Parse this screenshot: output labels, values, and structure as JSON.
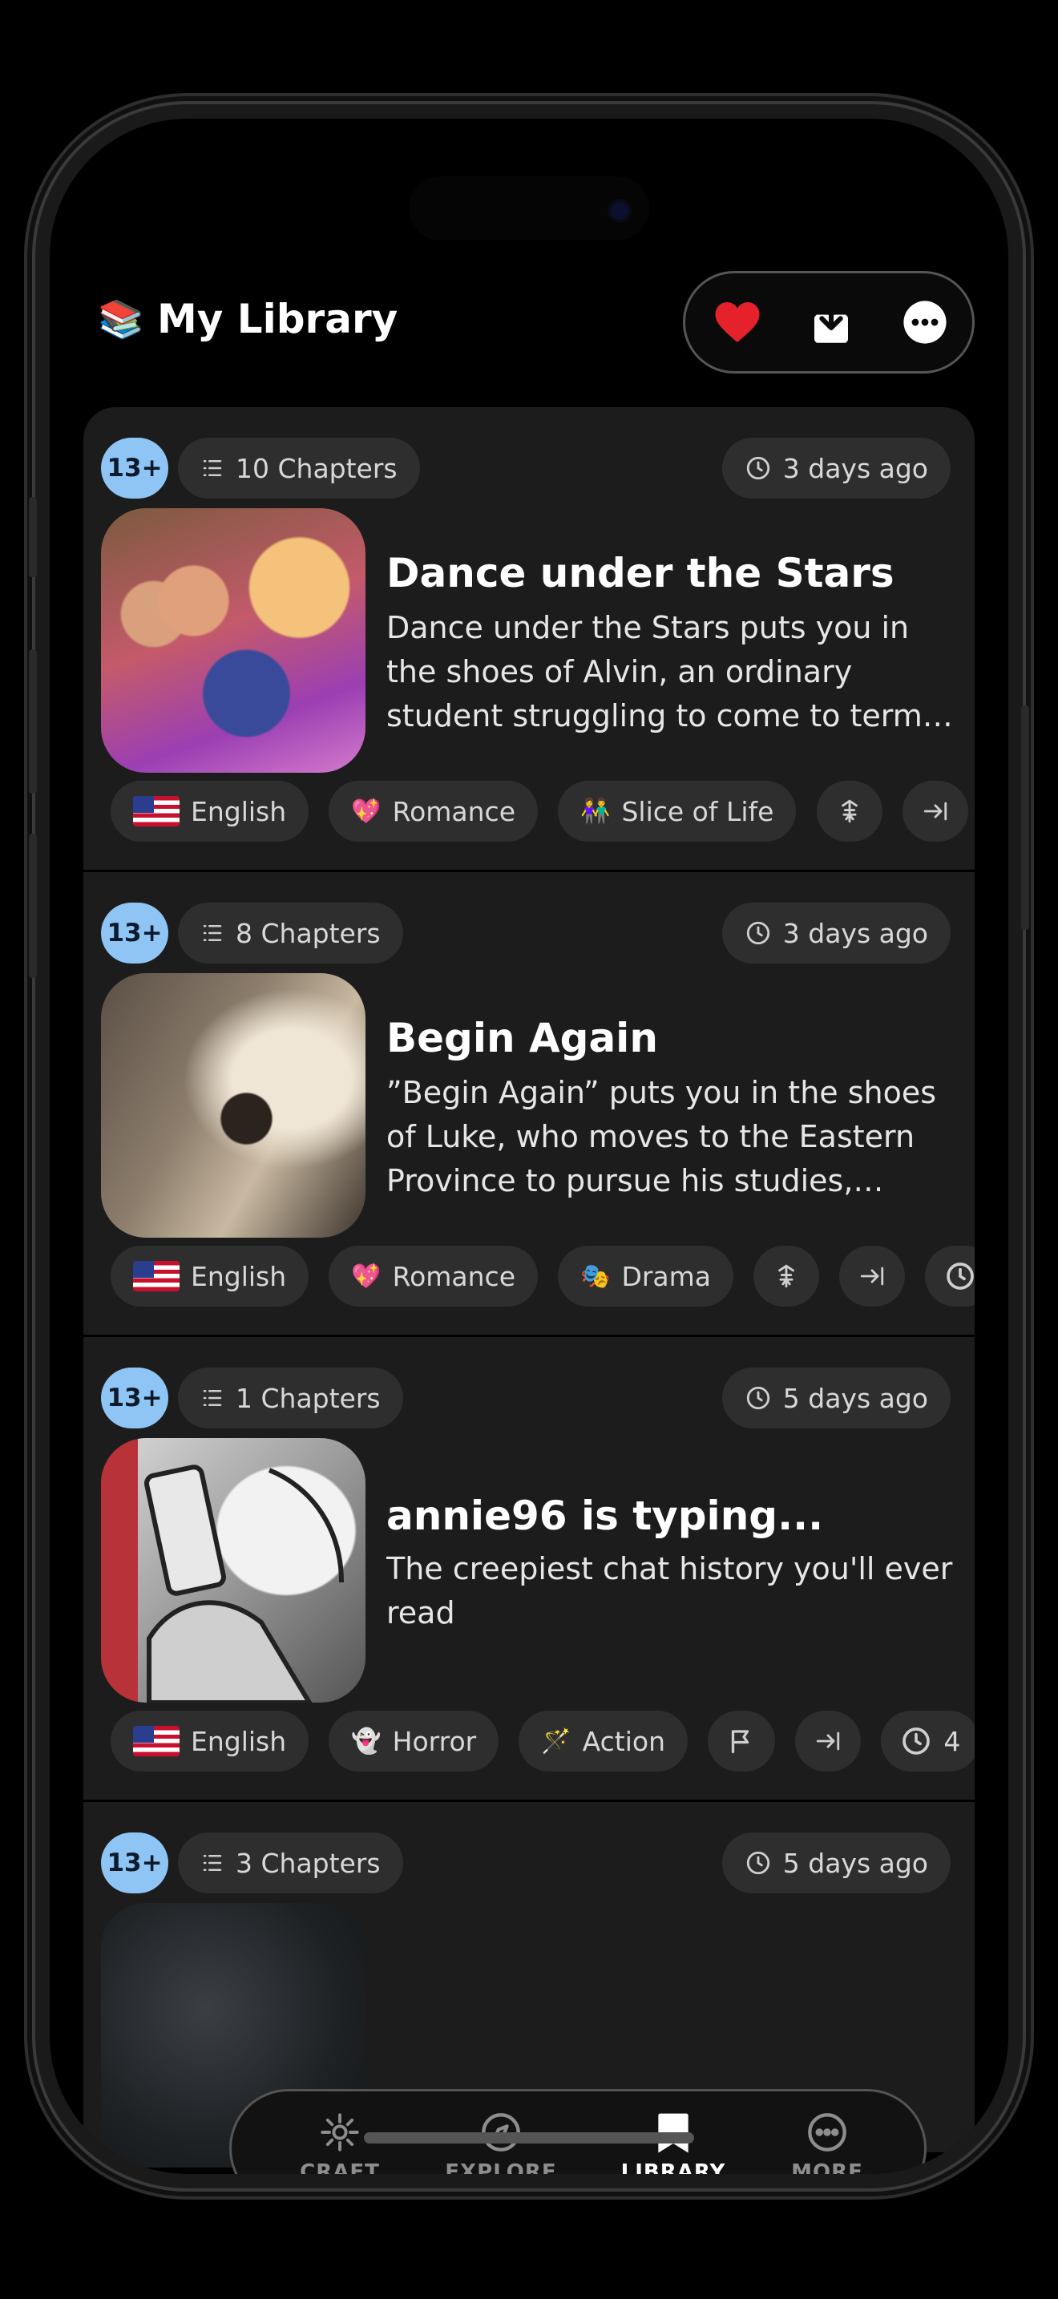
{
  "header": {
    "emoji": "📚",
    "title": "My Library",
    "actions": [
      "heart-icon",
      "download-icon",
      "more-icon"
    ]
  },
  "stories": [
    {
      "age": "13+",
      "chapters": "10 Chapters",
      "updated": "3 days ago",
      "title": "Dance under the Stars",
      "description": "Dance under the Stars puts you in the shoes of Alvin, an ordinary student struggling to come to terms with a l...",
      "tags": [
        {
          "icon": "us-flag",
          "label": "English"
        },
        {
          "icon": "💖",
          "label": "Romance"
        },
        {
          "icon": "👫",
          "label": "Slice of Life"
        }
      ],
      "extra_icons": [
        "perspective-icon",
        "arrow-to-end-icon"
      ]
    },
    {
      "age": "13+",
      "chapters": "8 Chapters",
      "updated": "3 days ago",
      "title": "Begin Again",
      "description": "”Begin Again” puts you in the shoes of Luke, who moves to the Eastern Province to pursue his studies, leavi...",
      "tags": [
        {
          "icon": "us-flag",
          "label": "English"
        },
        {
          "icon": "💖",
          "label": "Romance"
        },
        {
          "icon": "🎭",
          "label": "Drama"
        }
      ],
      "extra_icons": [
        "perspective-icon",
        "arrow-to-end-icon",
        "clock-icon"
      ]
    },
    {
      "age": "13+",
      "chapters": "1 Chapters",
      "updated": "5 days ago",
      "title": "annie96 is typing...",
      "description": "The creepiest chat history you'll ever read",
      "tags": [
        {
          "icon": "us-flag",
          "label": "English"
        },
        {
          "icon": "👻",
          "label": "Horror"
        },
        {
          "icon": "🪄",
          "label": "Action"
        }
      ],
      "extra_icons": [
        "flag-icon",
        "arrow-to-end-icon",
        "clock-icon"
      ],
      "clock_value": "4"
    },
    {
      "age": "13+",
      "chapters": "3 Chapters",
      "updated": "5 days ago"
    }
  ],
  "tabbar": [
    {
      "label": "CRAFT",
      "icon": "sparkle-icon"
    },
    {
      "label": "EXPLORE",
      "icon": "compass-icon"
    },
    {
      "label": "LIBRARY",
      "icon": "bookmark-icon",
      "active": true
    },
    {
      "label": "MORE",
      "icon": "more-icon"
    }
  ],
  "colors": {
    "age_badge": "#8ec5f5",
    "heart": "#e5222c",
    "card_bg": "#1c1c1c",
    "chip_bg": "#2e2e2e"
  }
}
